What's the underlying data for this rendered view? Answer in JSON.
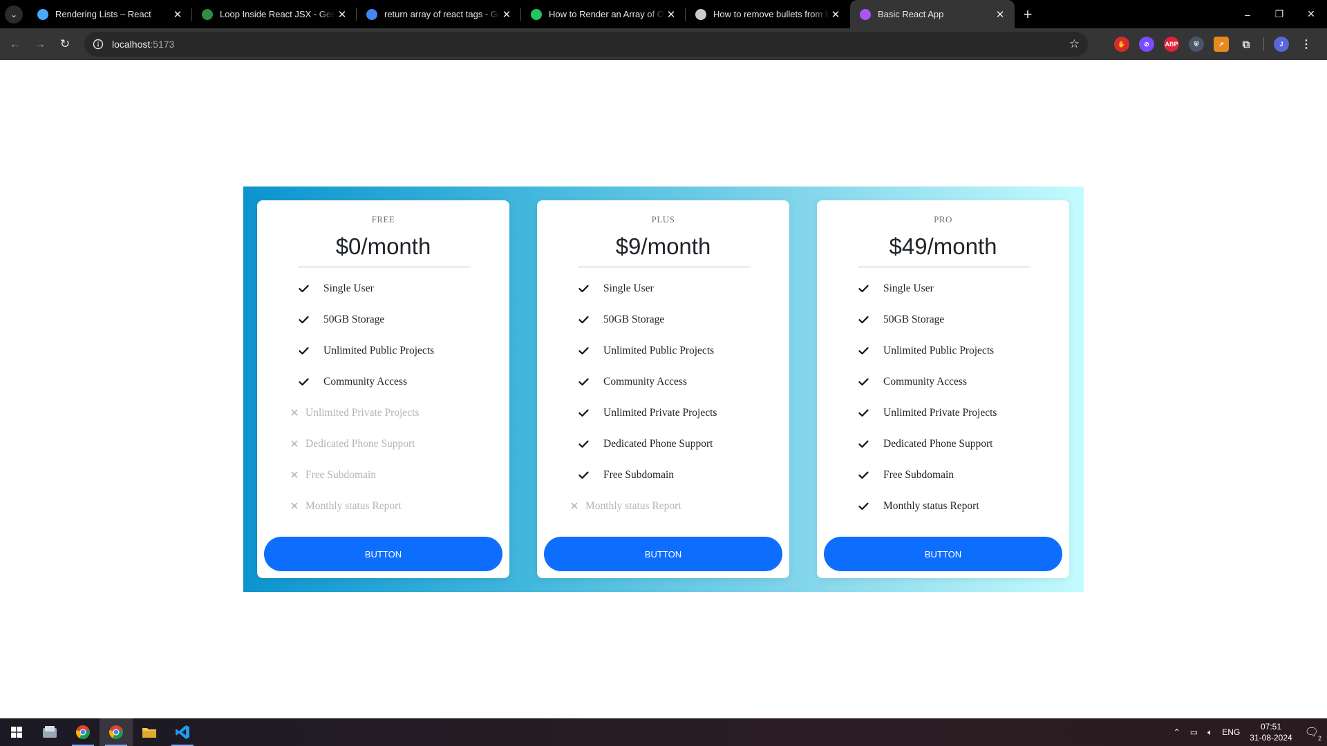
{
  "browser": {
    "tabs": [
      {
        "title": "Rendering Lists – React",
        "favicon": "react-gear-icon",
        "color": "#4aa8ff"
      },
      {
        "title": "Loop Inside React JSX - GeeksforGeeks",
        "favicon": "geeksforgeeks-icon",
        "color": "#2f8d46"
      },
      {
        "title": "return array of react tags - Google Search",
        "favicon": "google-icon",
        "color": "#4285f4"
      },
      {
        "title": "How to Render an Array of Objects in ReactJS",
        "favicon": "green-badge-icon",
        "color": "#22c55e"
      },
      {
        "title": "How to remove bullets from li (",
        "favicon": "page-icon",
        "color": "#cccccc"
      },
      {
        "title": "Basic React App",
        "favicon": "vite-icon",
        "color": "#a855f7"
      }
    ],
    "active_tab": 5,
    "address": {
      "host": "localhost",
      "port": ":5173"
    }
  },
  "pricing": {
    "cards": [
      {
        "tier": "FREE",
        "price": "$0/month",
        "features": [
          {
            "label": "Single User",
            "included": true
          },
          {
            "label": "50GB Storage",
            "included": true
          },
          {
            "label": "Unlimited Public Projects",
            "included": true
          },
          {
            "label": "Community Access",
            "included": true
          },
          {
            "label": "Unlimited Private Projects",
            "included": false
          },
          {
            "label": "Dedicated Phone Support",
            "included": false
          },
          {
            "label": "Free Subdomain",
            "included": false
          },
          {
            "label": "Monthly status Report",
            "included": false
          }
        ],
        "button": "BUTTON"
      },
      {
        "tier": "PLUS",
        "price": "$9/month",
        "features": [
          {
            "label": "Single User",
            "included": true
          },
          {
            "label": "50GB Storage",
            "included": true
          },
          {
            "label": "Unlimited Public Projects",
            "included": true
          },
          {
            "label": "Community Access",
            "included": true
          },
          {
            "label": "Unlimited Private Projects",
            "included": true
          },
          {
            "label": "Dedicated Phone Support",
            "included": true
          },
          {
            "label": "Free Subdomain",
            "included": true
          },
          {
            "label": "Monthly status Report",
            "included": false
          }
        ],
        "button": "BUTTON"
      },
      {
        "tier": "PRO",
        "price": "$49/month",
        "features": [
          {
            "label": "Single User",
            "included": true
          },
          {
            "label": "50GB Storage",
            "included": true
          },
          {
            "label": "Unlimited Public Projects",
            "included": true
          },
          {
            "label": "Community Access",
            "included": true
          },
          {
            "label": "Unlimited Private Projects",
            "included": true
          },
          {
            "label": "Dedicated Phone Support",
            "included": true
          },
          {
            "label": "Free Subdomain",
            "included": true
          },
          {
            "label": "Monthly status Report",
            "included": true
          }
        ],
        "button": "BUTTON"
      }
    ],
    "colors": {
      "button": "#0d6efd",
      "included_text": "#212529",
      "excluded_text": "#b5b5b5"
    }
  },
  "taskbar": {
    "apps": [
      "windows-start-icon",
      "file-manager-icon",
      "chrome-icon",
      "chrome-icon",
      "file-explorer-icon",
      "vscode-icon"
    ],
    "language": "ENG",
    "time": "07:51",
    "date": "31-08-2024",
    "notification_count": "2"
  }
}
